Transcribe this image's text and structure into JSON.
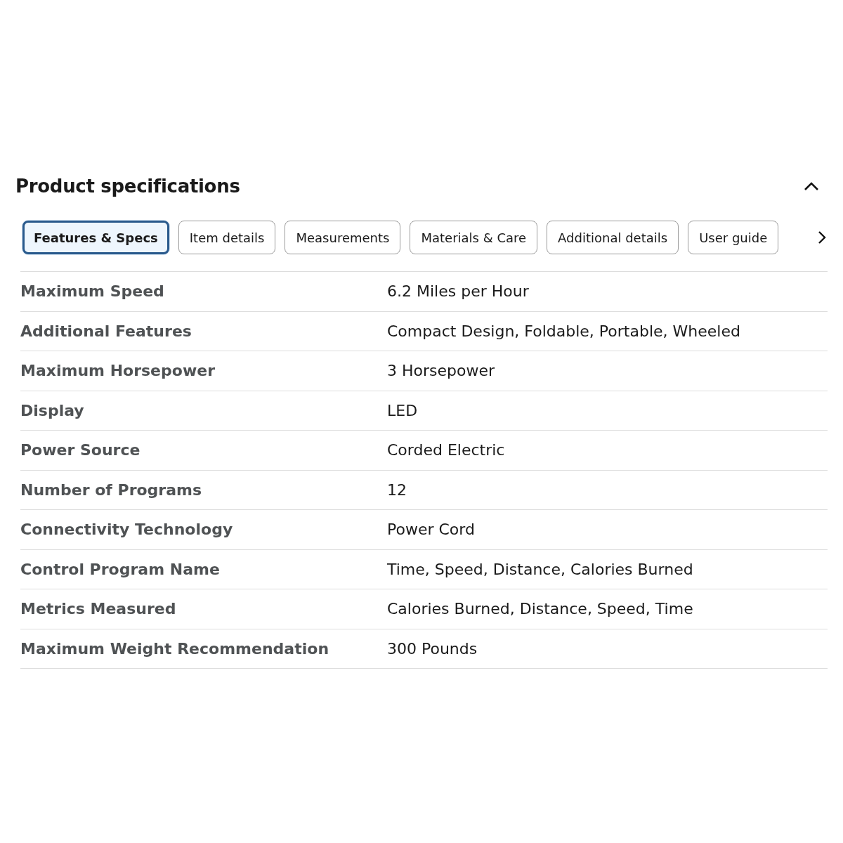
{
  "section": {
    "title": "Product specifications",
    "expanded": true
  },
  "tabs": [
    {
      "label": "Features & Specs",
      "selected": true
    },
    {
      "label": "Item details",
      "selected": false
    },
    {
      "label": "Measurements",
      "selected": false
    },
    {
      "label": "Materials & Care",
      "selected": false
    },
    {
      "label": "Additional details",
      "selected": false
    },
    {
      "label": "User guide",
      "selected": false
    }
  ],
  "specs": [
    {
      "name": "Maximum Speed",
      "value": "6.2 Miles per Hour"
    },
    {
      "name": "Additional Features",
      "value": "Compact Design, Foldable, Portable, Wheeled"
    },
    {
      "name": "Maximum Horsepower",
      "value": "3 Horsepower"
    },
    {
      "name": "Display",
      "value": "LED"
    },
    {
      "name": "Power Source",
      "value": "Corded Electric"
    },
    {
      "name": "Number of Programs",
      "value": "12"
    },
    {
      "name": "Connectivity Technology",
      "value": "Power Cord"
    },
    {
      "name": "Control Program Name",
      "value": "Time, Speed, Distance, Calories Burned"
    },
    {
      "name": "Metrics Measured",
      "value": "Calories Burned, Distance, Speed, Time"
    },
    {
      "name": "Maximum Weight Recommendation",
      "value": "300 Pounds"
    }
  ]
}
